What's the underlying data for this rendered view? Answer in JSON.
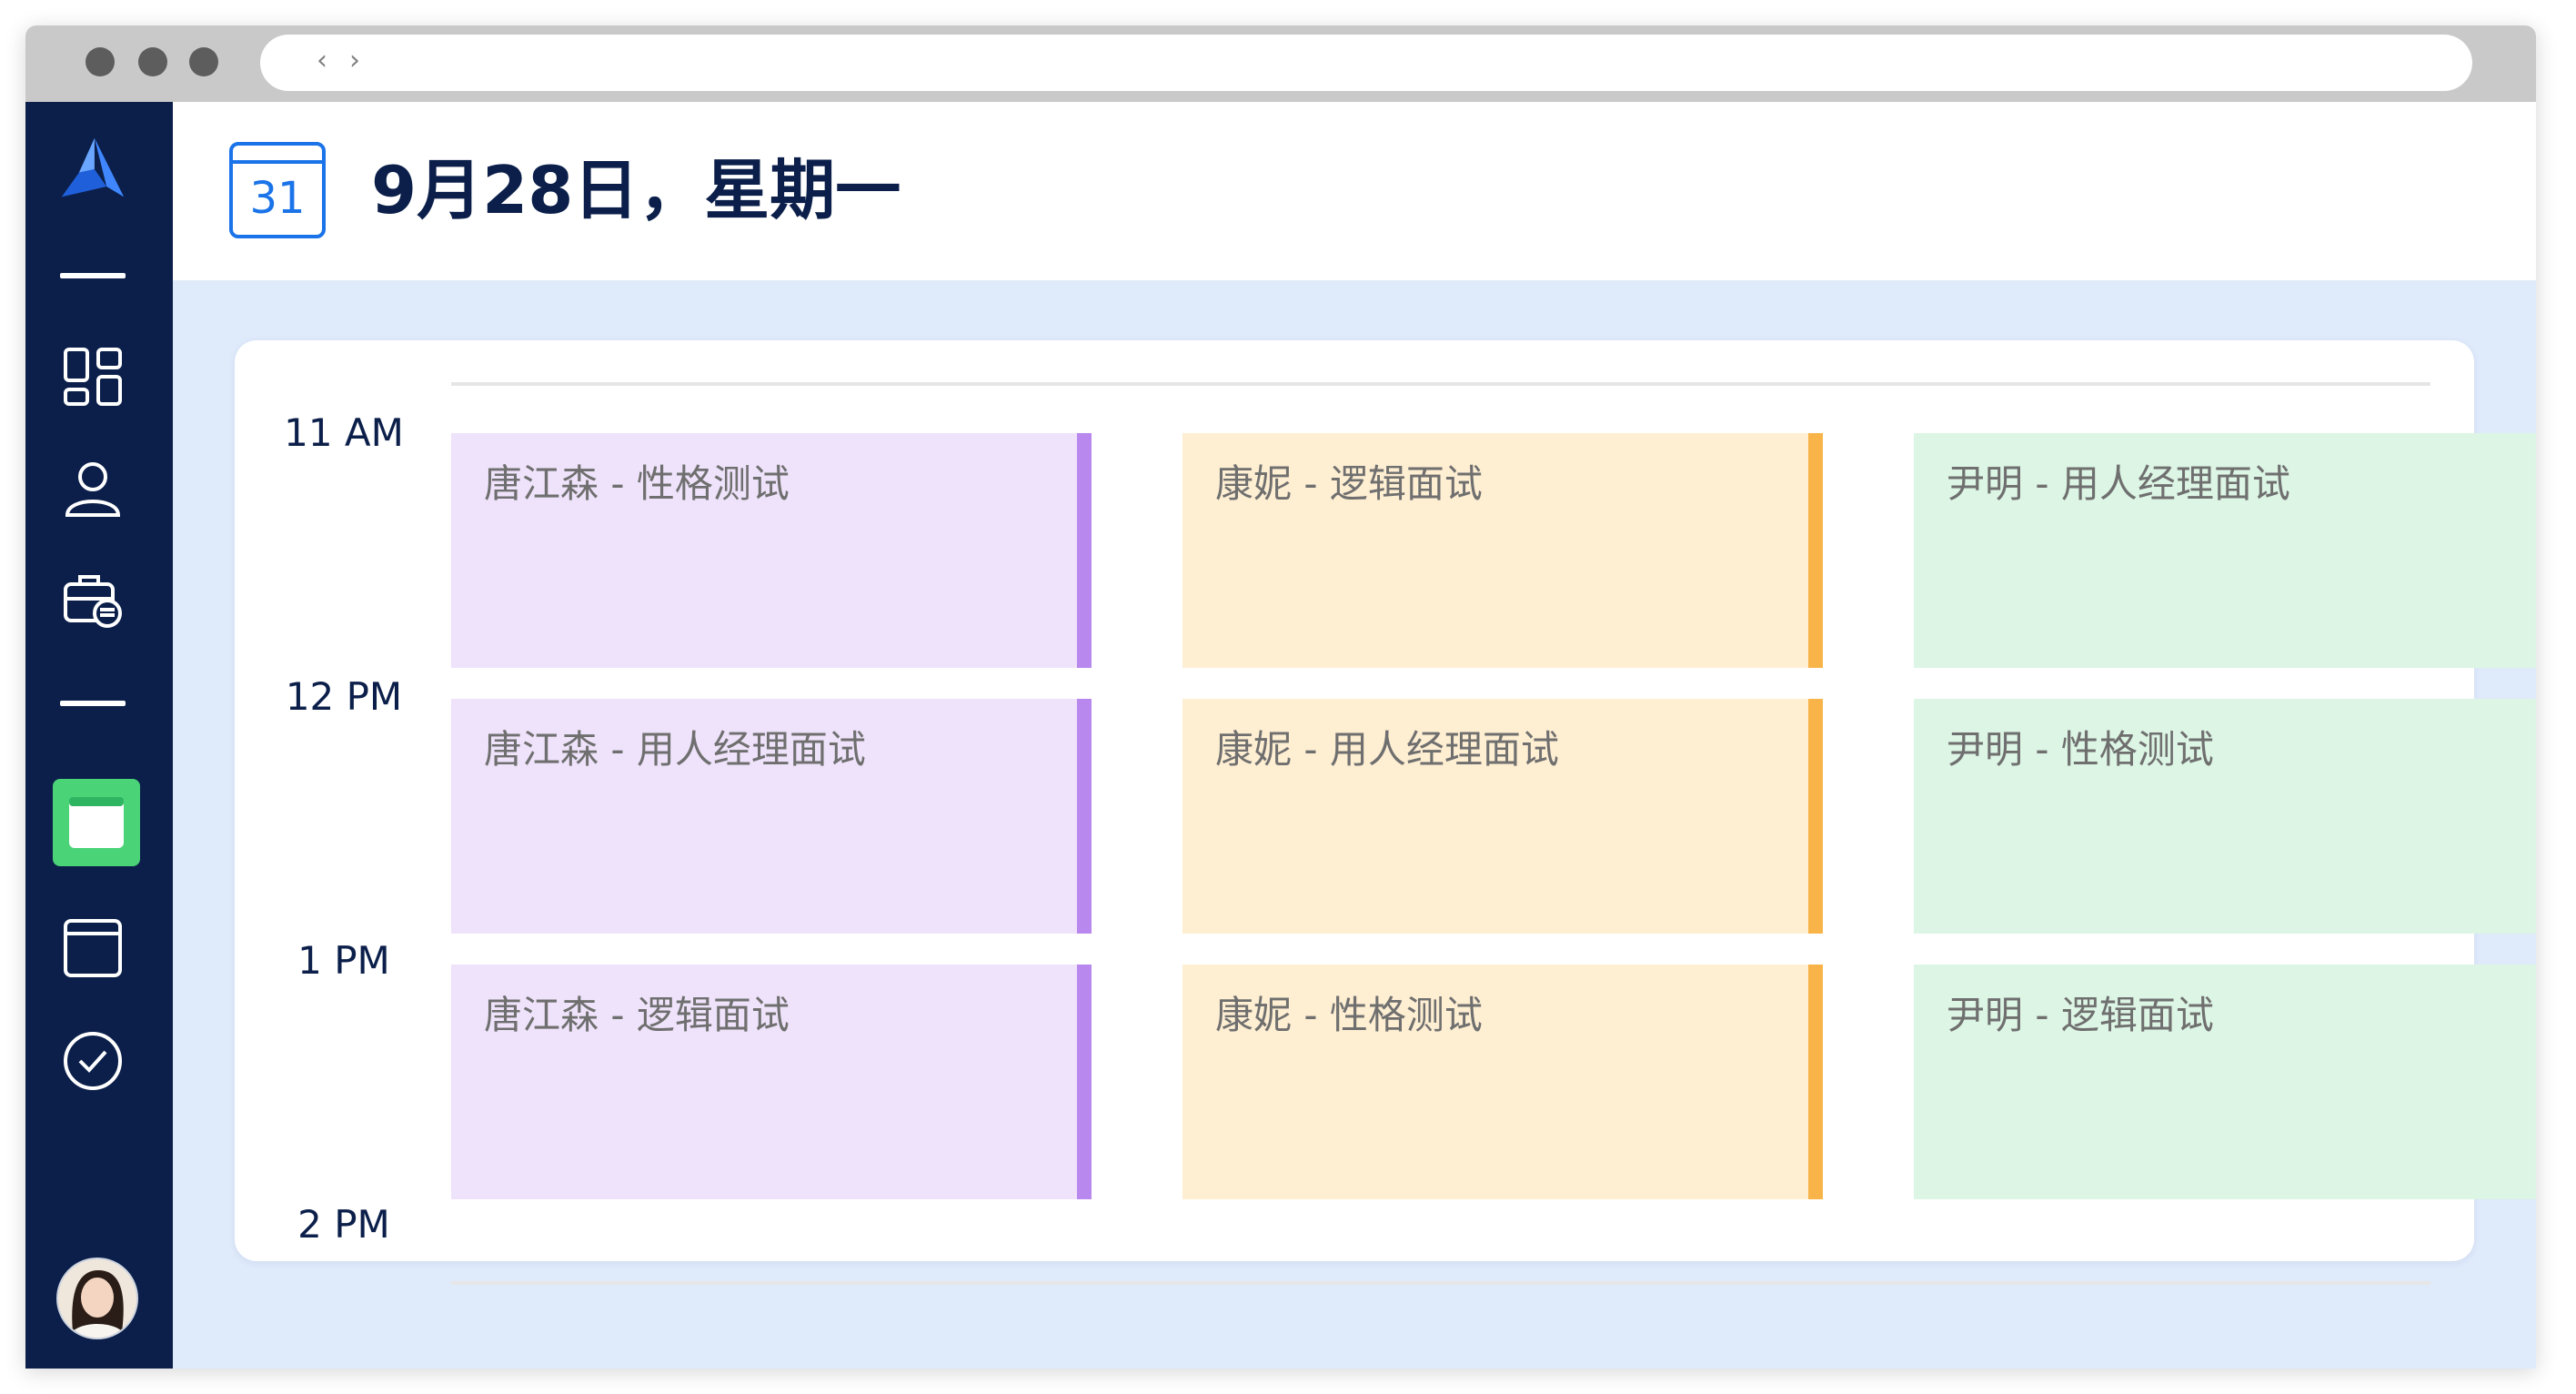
{
  "browser": {
    "back_glyph": "‹",
    "forward_glyph": "›"
  },
  "sidebar": {
    "logo": "app-logo-icon",
    "icons": [
      "dashboard-icon",
      "user-icon",
      "briefcase-icon",
      "calendar-active-icon",
      "calendar-icon",
      "check-circle-icon"
    ],
    "active_color": "#4ad377"
  },
  "header": {
    "calendar_day": "31",
    "title": "9月28日，星期一"
  },
  "timeline": {
    "times": [
      "11 AM",
      "12 PM",
      "1 PM",
      "2 PM"
    ]
  },
  "columns": [
    {
      "bg": "#efe3fb",
      "accent": "#b888ee",
      "events": [
        "唐江森 - 性格测试",
        "唐江森 - 用人经理面试",
        "唐江森 - 逻辑面试"
      ]
    },
    {
      "bg": "#feeed2",
      "accent": "#f8b448",
      "events": [
        "康妮 - 逻辑面试",
        "康妮 - 用人经理面试",
        "康妮 - 性格测试"
      ]
    },
    {
      "bg": "#dcf5e4",
      "accent": "#74d98e",
      "events": [
        "尹明 - 用人经理面试",
        "尹明 - 性格测试",
        "尹明 - 逻辑面试"
      ]
    }
  ]
}
